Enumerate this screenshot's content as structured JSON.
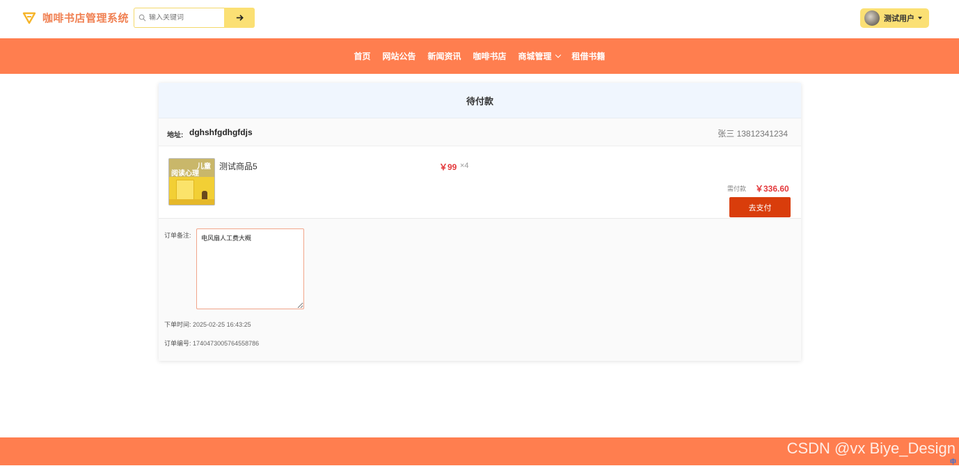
{
  "app": {
    "title": "咖啡书店管理系统",
    "brand_color": "#ff7e4f"
  },
  "search": {
    "placeholder": "输入关键词"
  },
  "user": {
    "name": "测试用户"
  },
  "nav": {
    "items": [
      {
        "label": "首页"
      },
      {
        "label": "网站公告"
      },
      {
        "label": "新闻资讯"
      },
      {
        "label": "咖啡书店"
      },
      {
        "label": "商城管理"
      },
      {
        "label": "租借书籍"
      }
    ]
  },
  "order": {
    "status_title": "待付款",
    "address_label": "地址:",
    "address": "dghshfgdhgfdjs",
    "contact": "张三 13812341234",
    "item": {
      "book_title_line1": "儿童",
      "book_title_line2": "阅读心理",
      "name": "测试商品5",
      "price": "￥99",
      "quantity": "×4"
    },
    "pay_label": "需付款",
    "pay_amount": "￥336.60",
    "pay_button": "去支付",
    "remark_label": "订单备注:",
    "remark_value": "电风扇人工费大概",
    "time_label": "下单时间:",
    "time_value": "2025-02-25 16:43:25",
    "number_label": "订单编号:",
    "number_value": "1740473005764558786"
  },
  "watermark": "CSDN @vx Biye_Design",
  "tray": {
    "ime": "中"
  }
}
